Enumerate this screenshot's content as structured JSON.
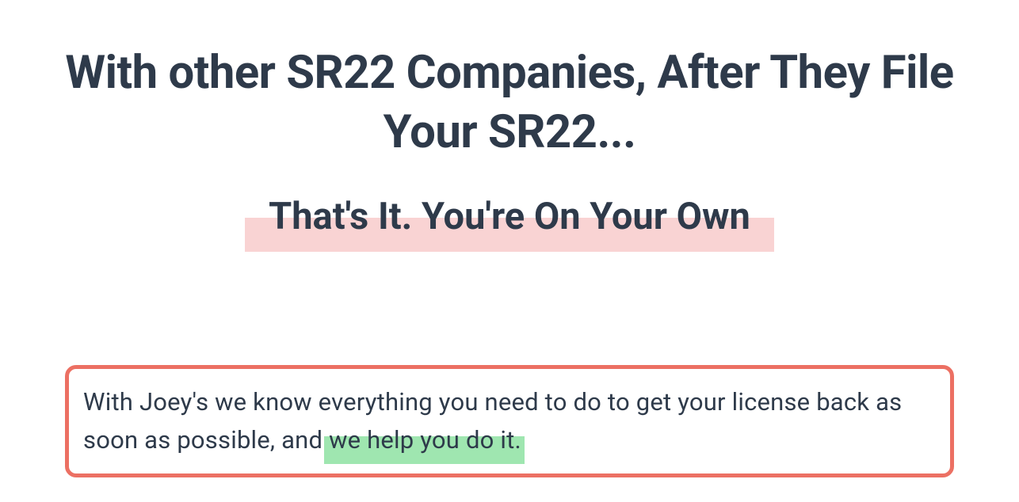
{
  "heading": "With other SR22 Companies, After They File Your SR22...",
  "subheading": "That's It. You're On Your Own",
  "callout": {
    "text_before": "With Joey's we know everything you need to do to get your license back as soon as possible, and ",
    "highlighted": " we help you do it."
  }
}
